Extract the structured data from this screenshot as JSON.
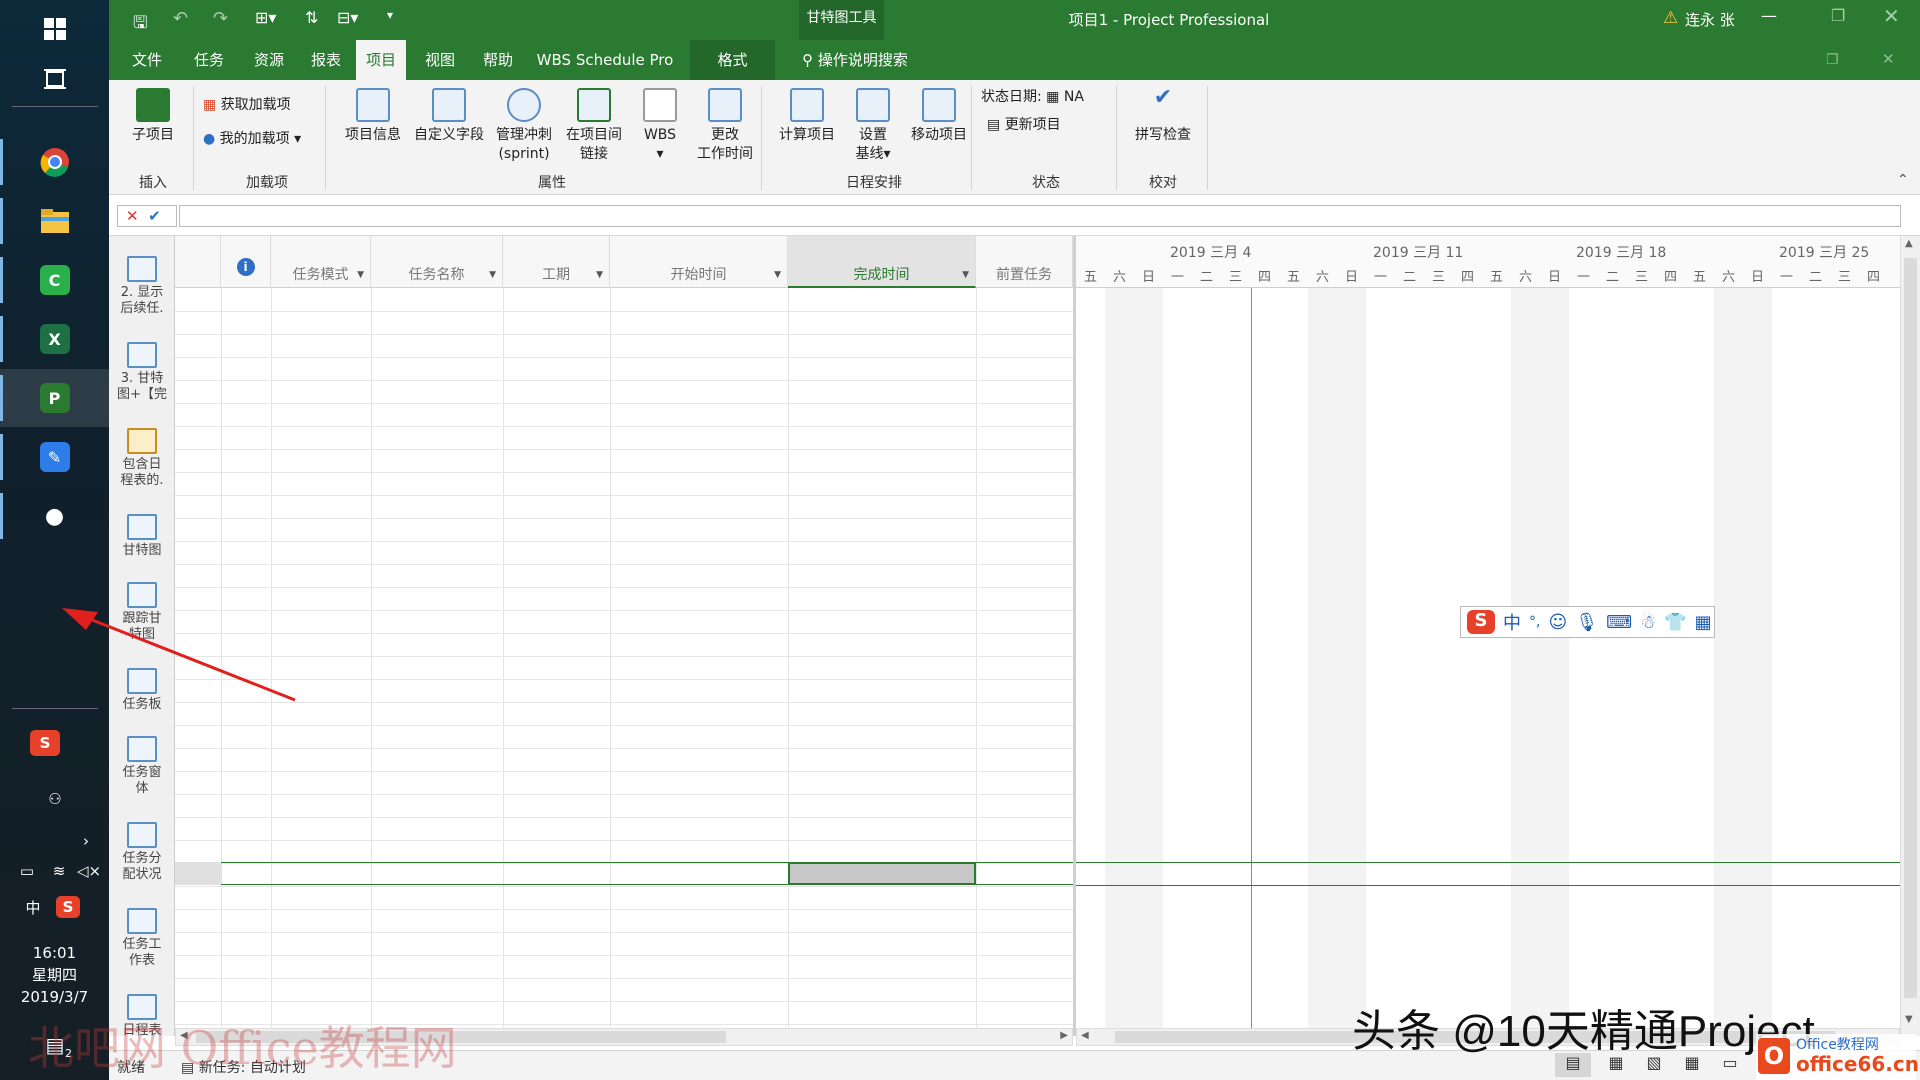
{
  "titlebar": {
    "title": "项目1  -  Project Professional",
    "context_group": "甘特图工具",
    "user": "连永 张",
    "warning_glyph": "⚠"
  },
  "tabs": [
    {
      "label": "文件"
    },
    {
      "label": "任务"
    },
    {
      "label": "资源"
    },
    {
      "label": "报表"
    },
    {
      "label": "项目"
    },
    {
      "label": "视图"
    },
    {
      "label": "帮助"
    },
    {
      "label": "WBS Schedule Pro"
    },
    {
      "label": "格式"
    }
  ],
  "active_tab": "项目",
  "search_label": "操作说明搜索",
  "ribbon": {
    "groups": {
      "insert": "插入",
      "addins": "加载项",
      "properties": "属性",
      "schedule": "日程安排",
      "status": "状态",
      "proofing": "校对"
    },
    "buttons": {
      "subproject": "子项目",
      "get_addins": "获取加载项",
      "my_addins": "我的加载项",
      "project_info": "项目信息",
      "custom_fields": "自定义字段",
      "manage_sprint_1": "管理冲刺",
      "manage_sprint_2": "(sprint)",
      "links_1": "在项目间",
      "links_2": "链接",
      "wbs": "WBS",
      "change_time_1": "更改",
      "change_time_2": "工作时间",
      "calc_project": "计算项目",
      "baseline_1": "设置",
      "baseline_2": "基线",
      "move_project": "移动项目",
      "status_date_label": "状态日期:",
      "status_date_value": "NA",
      "update_project": "更新项目",
      "spelling": "拼写检查"
    }
  },
  "formula": {
    "cancel": "✕",
    "confirm": "✔"
  },
  "viewbar": [
    {
      "l1": "2. 显示",
      "l2": "后续任."
    },
    {
      "l1": "3. 甘特",
      "l2": "图+【完"
    },
    {
      "l1": "包含日",
      "l2": "程表的."
    },
    {
      "l1": "甘特图",
      "l2": ""
    },
    {
      "l1": "跟踪甘",
      "l2": "特图"
    },
    {
      "l1": "任务板",
      "l2": ""
    },
    {
      "l1": "任务窗",
      "l2": "体"
    },
    {
      "l1": "任务分",
      "l2": "配状况"
    },
    {
      "l1": "任务工",
      "l2": "作表"
    },
    {
      "l1": "日程表",
      "l2": ""
    }
  ],
  "grid": {
    "info_icon": "i",
    "columns": [
      "任务模式",
      "任务名称",
      "工期",
      "开始时间",
      "完成时间",
      "前置任务"
    ],
    "selected_column": "完成时间"
  },
  "gantt": {
    "weeks": [
      "2019 三月 4",
      "2019 三月 11",
      "2019 三月 18",
      "2019 三月 25"
    ],
    "days": [
      "五",
      "六",
      "日",
      "一",
      "二",
      "三",
      "四",
      "五",
      "六",
      "日",
      "一",
      "二",
      "三",
      "四",
      "五",
      "六",
      "日",
      "一",
      "二",
      "三",
      "四",
      "五",
      "六",
      "日",
      "一",
      "二",
      "三",
      "四"
    ]
  },
  "status": {
    "ready": "就绪",
    "new_tasks": "新任务: 自动计划"
  },
  "taskbar": {
    "time": "16:01",
    "weekday": "星期四",
    "date": "2019/3/7",
    "ime_lang": "中",
    "notif_count": "2"
  },
  "ime_toolbar": {
    "mode": "中",
    "punct": "°,"
  },
  "watermarks": {
    "left": "北吧网 Office教程网",
    "center": "头条 @10天精通Project",
    "logo": "office66.cn",
    "logo_top": "Office教程网"
  }
}
